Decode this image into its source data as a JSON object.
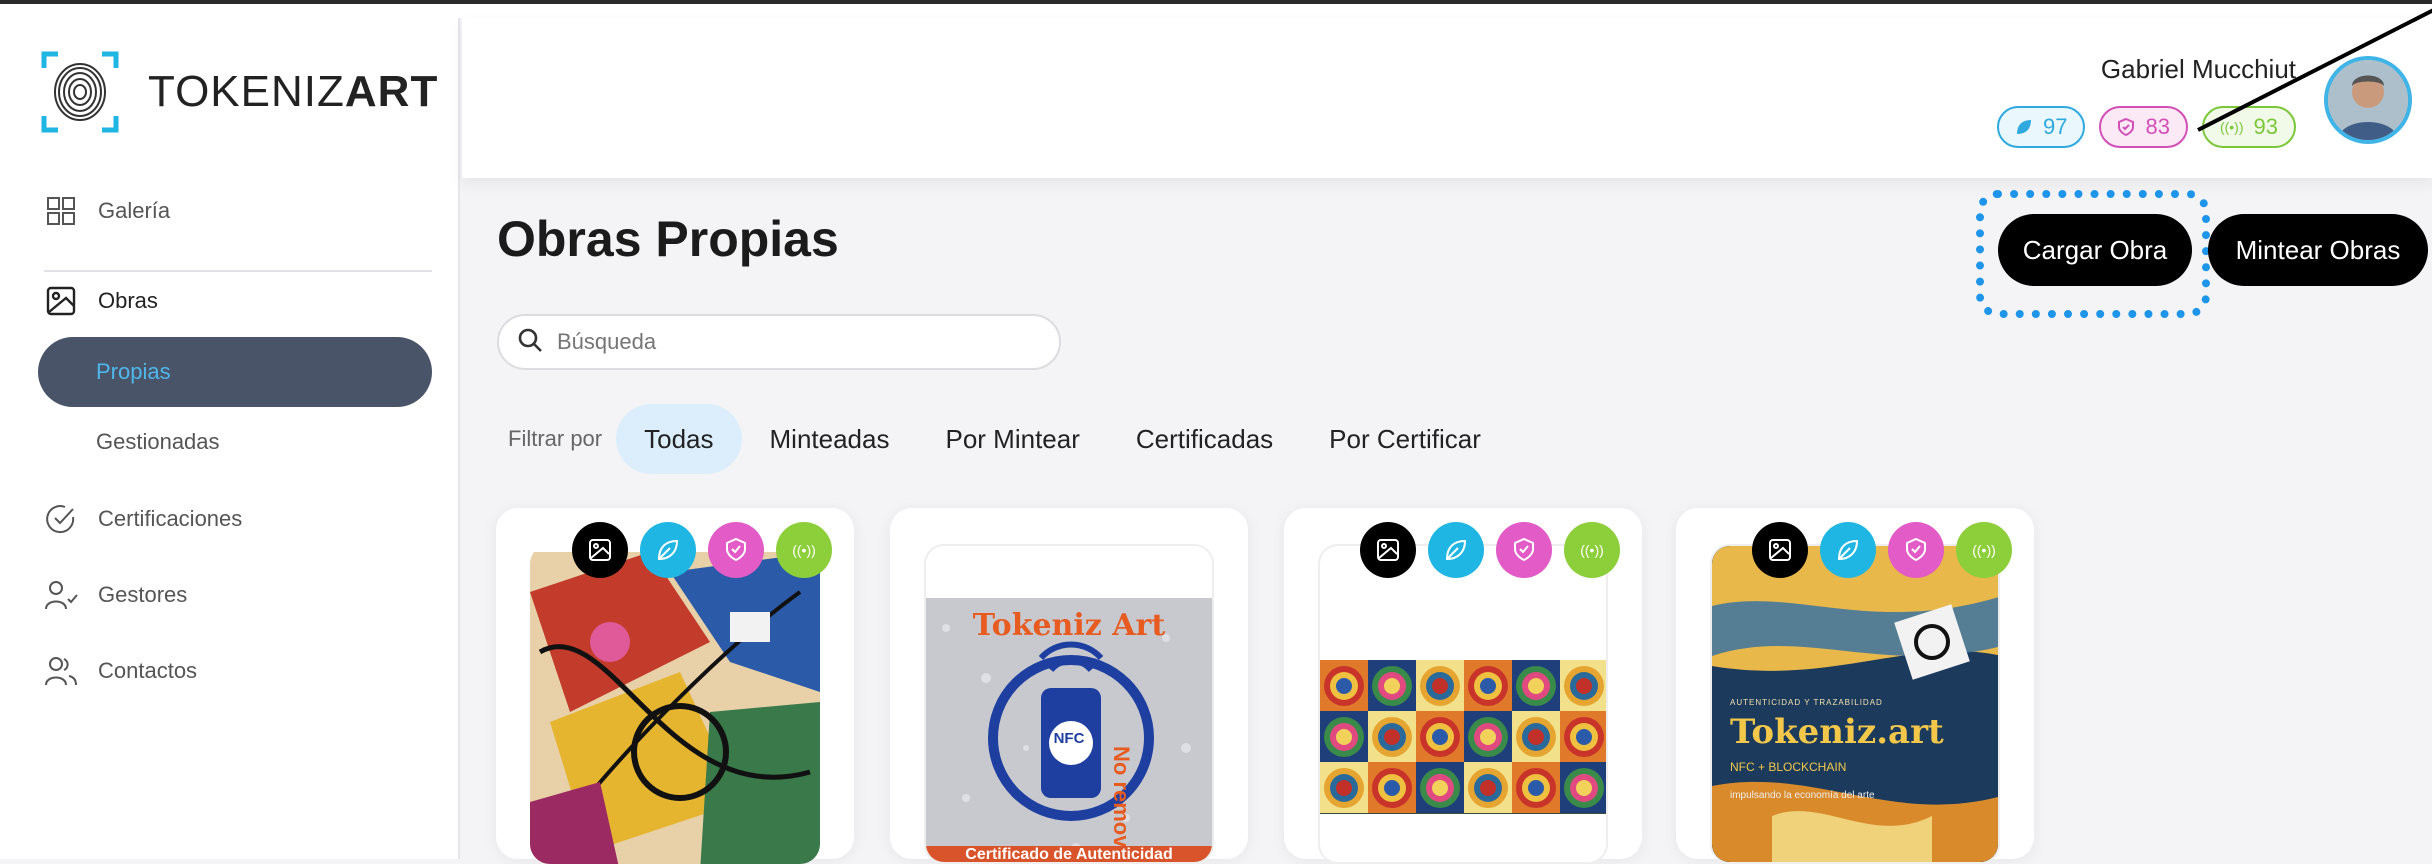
{
  "brand": {
    "name_light": "TOKENIZ",
    "name_bold": "ART"
  },
  "sidebar": {
    "items": [
      {
        "label": "Galería",
        "icon": "grid-icon"
      },
      {
        "label": "Obras",
        "icon": "image-icon"
      },
      {
        "label": "Certificaciones",
        "icon": "check-circle-icon"
      },
      {
        "label": "Gestores",
        "icon": "user-check-icon"
      },
      {
        "label": "Contactos",
        "icon": "users-icon"
      }
    ],
    "sub_items": [
      {
        "label": "Propias",
        "active": true
      },
      {
        "label": "Gestionadas",
        "active": false
      }
    ]
  },
  "header": {
    "user_name": "Gabriel Mucchiut",
    "badges": [
      {
        "value": "97",
        "icon": "leaf-icon",
        "color": "#2fa9de"
      },
      {
        "value": "83",
        "icon": "shield-icon",
        "color": "#d24fb7"
      },
      {
        "value": "93",
        "icon": "nfc-icon",
        "color": "#7cc63a"
      }
    ]
  },
  "main": {
    "title": "Obras Propias",
    "buttons": {
      "upload": "Cargar Obra",
      "mint": "Mintear Obras"
    },
    "search_placeholder": "Búsqueda",
    "filter_label": "Filtrar por",
    "filters": [
      "Todas",
      "Minteadas",
      "Por Mintear",
      "Certificadas",
      "Por Certificar"
    ],
    "active_filter": "Todas",
    "card_artwork_text": {
      "card2_top": "Tokeniz Art",
      "card2_side": "No remover",
      "card2_center": "NFC",
      "card2_bottom": "Certificado de Autenticidad",
      "card4_small": "AUTENTICIDAD Y TRAZABILIDAD",
      "card4_brand": "Tokeniz.art",
      "card4_sub": "NFC + BLOCKCHAIN",
      "card4_tag": "impulsando la economía del arte"
    }
  },
  "colors": {
    "accent_blue": "#1e95e8",
    "sidebar_active": "#4a5468",
    "icon_black": "#000000",
    "icon_cyan": "#1fb6e4",
    "icon_pink": "#e25bc6",
    "icon_green": "#8ccf3a"
  }
}
